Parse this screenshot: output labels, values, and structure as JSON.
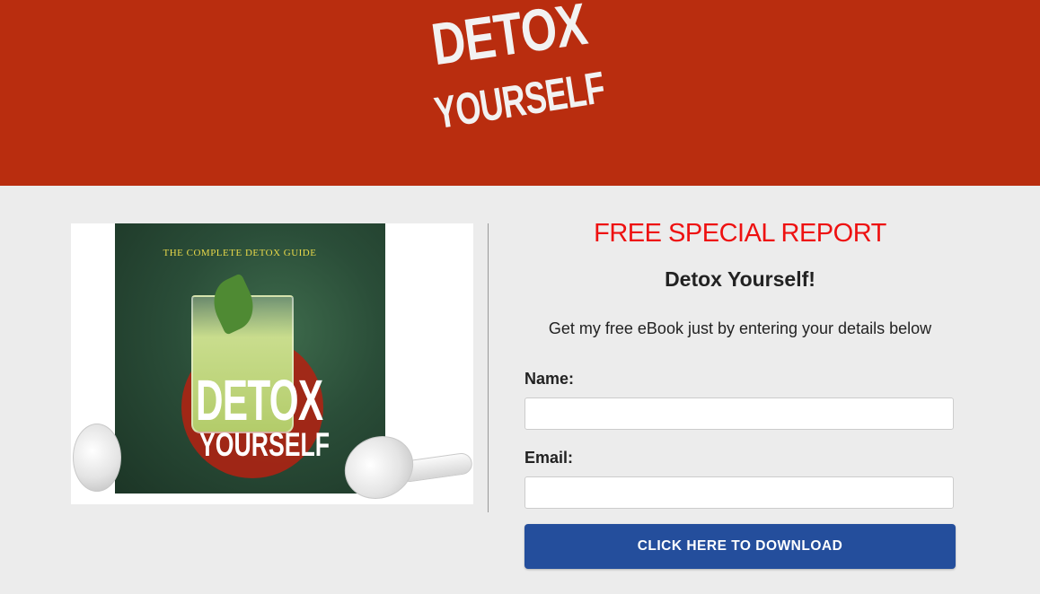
{
  "header": {
    "logo_line1": "DETOX",
    "logo_line2": "YOURSELF"
  },
  "product": {
    "cover_subtitle": "THE COMPLETE DETOX GUIDE",
    "cover_title_line1": "DETOX",
    "cover_title_line2": "YOURSELF"
  },
  "offer": {
    "title": "FREE SPECIAL REPORT",
    "subtitle": "Detox Yourself!",
    "description": "Get my free eBook just by entering your details below"
  },
  "form": {
    "name_label": "Name:",
    "name_value": "",
    "email_label": "Email:",
    "email_value": "",
    "submit_label": "CLICK HERE TO DOWNLOAD"
  },
  "colors": {
    "header_background": "#b92d0f",
    "title_red": "#ee1111",
    "button_blue": "#244e9c",
    "page_background": "#ececec"
  }
}
